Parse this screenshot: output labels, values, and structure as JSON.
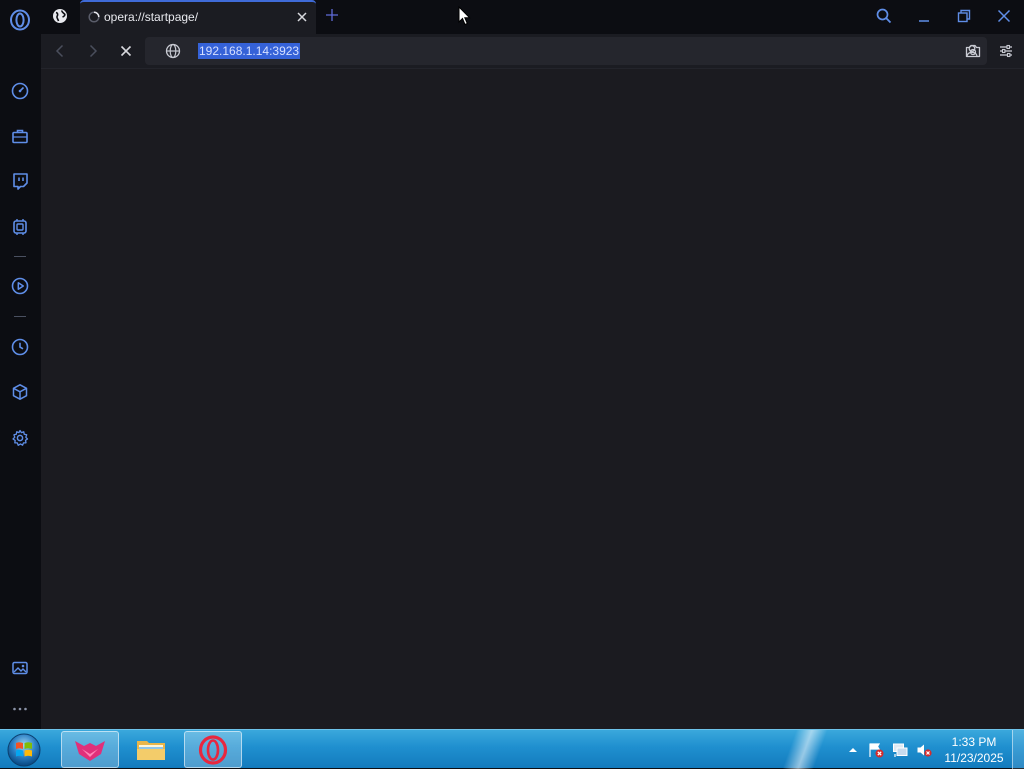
{
  "browser": {
    "active_tab_title": "opera://startpage/",
    "address_url": "192.168.1.14:3923",
    "accent_color": "#3f6bd8",
    "icon_color": "#5f8ee8"
  },
  "sidebar": {
    "items": [
      {
        "icon": "speed-dial-icon"
      },
      {
        "icon": "briefcase-icon"
      },
      {
        "icon": "twitch-icon"
      },
      {
        "icon": "ai-chip-icon"
      },
      {
        "icon": "play-circle-icon"
      },
      {
        "icon": "history-clock-icon"
      },
      {
        "icon": "cube-icon"
      },
      {
        "icon": "settings-gear-icon"
      },
      {
        "icon": "gallery-icon"
      },
      {
        "icon": "more-dots-icon"
      }
    ]
  },
  "taskbar": {
    "time": "1:33 PM",
    "date": "11/23/2025",
    "apps": [
      "gx-app",
      "file-explorer",
      "opera-browser"
    ]
  }
}
